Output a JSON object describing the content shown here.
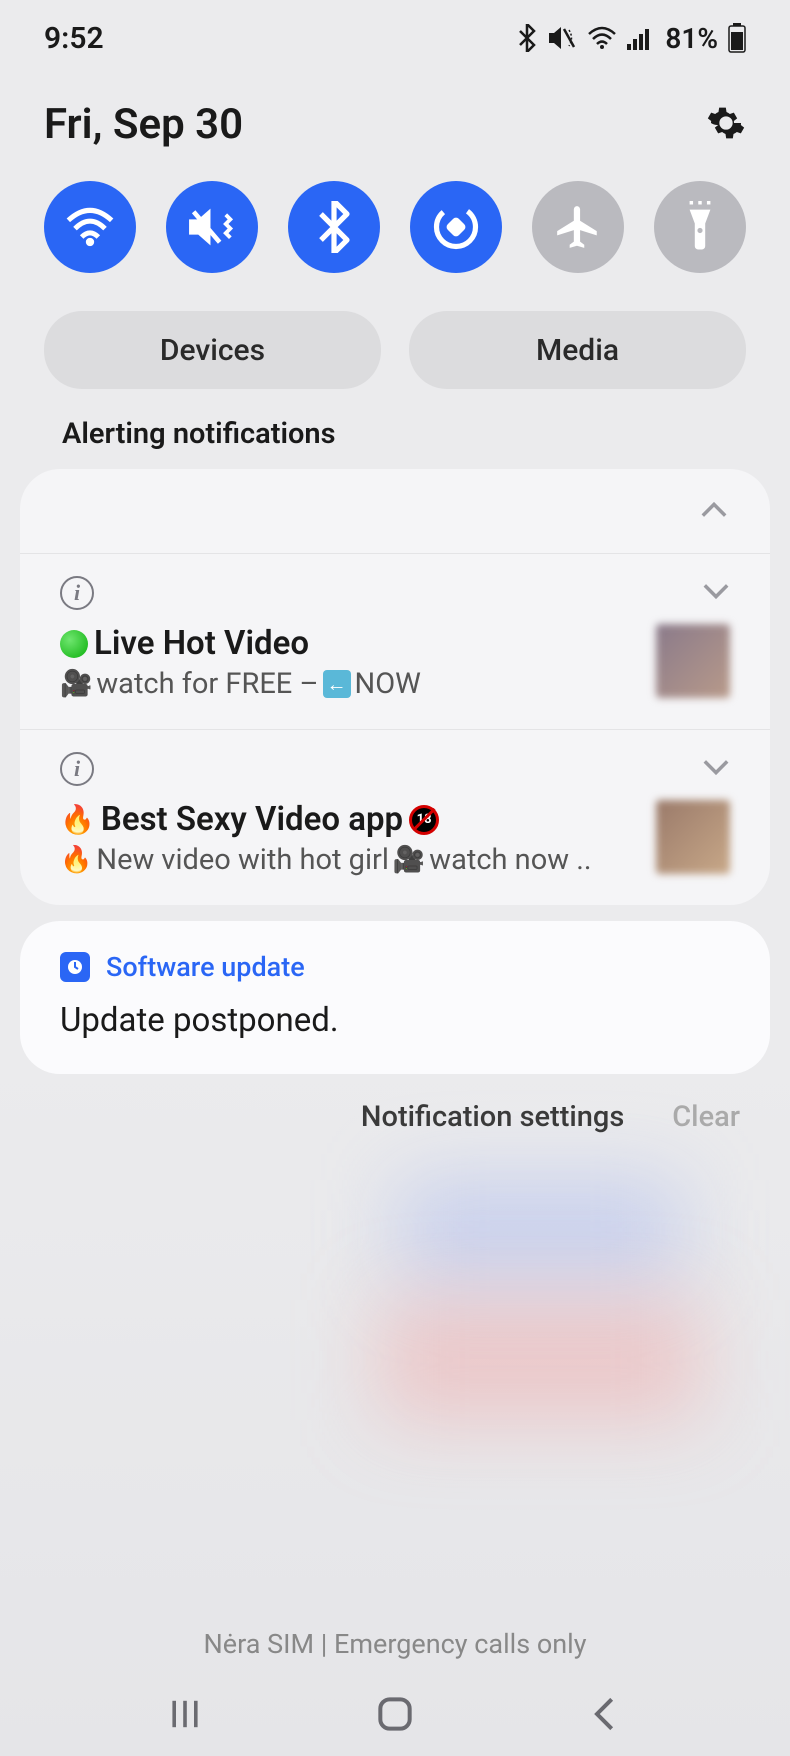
{
  "status": {
    "time": "9:52",
    "battery": "81%"
  },
  "header": {
    "date": "Fri, Sep 30"
  },
  "toggles": {
    "wifi": {
      "name": "wifi",
      "on": true
    },
    "mute": {
      "name": "sound-mute",
      "on": true
    },
    "bluetooth": {
      "name": "bluetooth",
      "on": true
    },
    "rotate": {
      "name": "auto-rotate",
      "on": true
    },
    "airplane": {
      "name": "airplane-mode",
      "on": false
    },
    "flashlight": {
      "name": "flashlight",
      "on": false
    }
  },
  "buttons": {
    "devices": "Devices",
    "media": "Media"
  },
  "section": {
    "alerting": "Alerting notifications"
  },
  "notifications": [
    {
      "title": "Live Hot Video",
      "subtitle_pre": "watch for FREE –",
      "subtitle_post": "NOW"
    },
    {
      "title": "Best Sexy Video app",
      "subtitle": "New video with hot girl",
      "subtitle_post": "watch now .."
    }
  ],
  "software_update": {
    "app": "Software update",
    "message": "Update postponed."
  },
  "footer": {
    "settings": "Notification settings",
    "clear": "Clear"
  },
  "sim": "Nėra SIM | Emergency calls only"
}
